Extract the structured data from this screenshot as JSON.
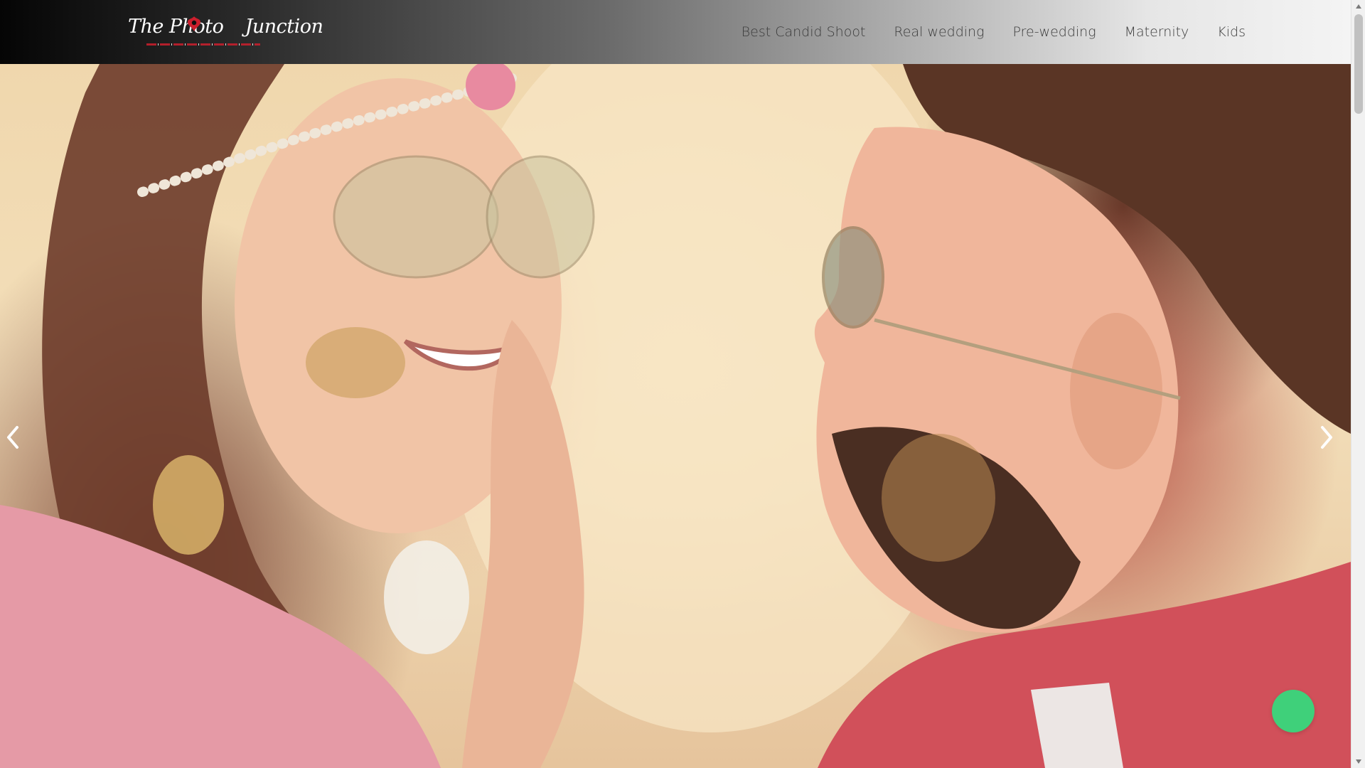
{
  "header": {
    "logo": {
      "text_left": "The Photo",
      "text_right": "Junction",
      "alt": "The Photo Junction logo"
    },
    "nav": [
      {
        "label": "Best Candid Shoot"
      },
      {
        "label": "Real wedding"
      },
      {
        "label": "Pre-wedding"
      },
      {
        "label": "Maternity"
      },
      {
        "label": "Kids"
      }
    ]
  },
  "hero": {
    "prev_icon": "chevron-left-icon",
    "next_icon": "chevron-right-icon"
  },
  "chat": {
    "icon": "chat-icon",
    "color": "#3fd07a"
  },
  "colors": {
    "brand_red": "#cc1f2d",
    "nav_text": "#3c3c3c",
    "header_dark": "#050505",
    "header_light": "#f4f4f4"
  }
}
